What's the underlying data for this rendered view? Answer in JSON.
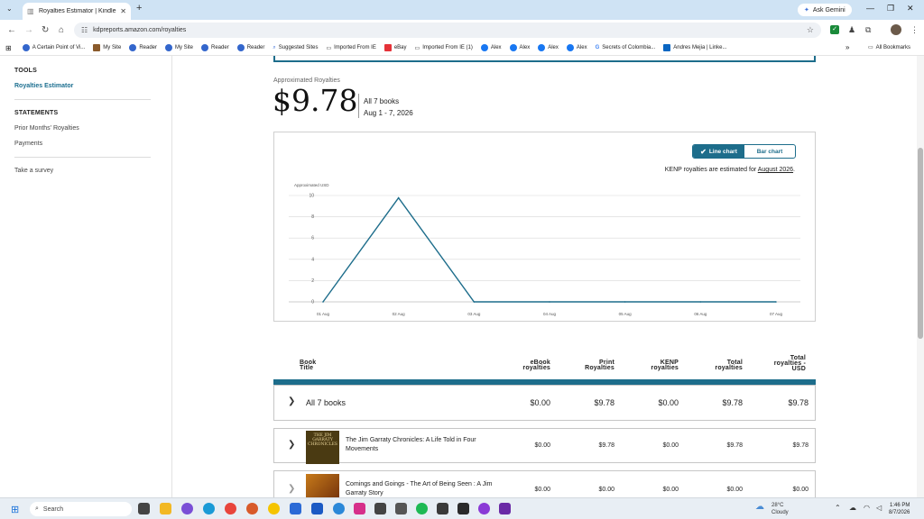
{
  "browser": {
    "tab_title": "Royalties Estimator | Kindle Dire...",
    "ask_gemini": "Ask Gemini",
    "url": "kdpreports.amazon.com/royalties",
    "bookmarks": [
      "A Certain Point of Vi...",
      "My Site",
      "Reader",
      "My Site",
      "Reader",
      "Reader",
      "Suggested Sites",
      "Imported From IE",
      "eBay",
      "Imported From IE (1)",
      "Alex",
      "Alex",
      "Alex",
      "Alex",
      "Secrets of Colombia...",
      "Andres Mejia | Linke..."
    ],
    "all_bookmarks": "All Bookmarks"
  },
  "sidebar": {
    "tools_heading": "TOOLS",
    "royalties_estimator": "Royalties Estimator",
    "statements_heading": "STATEMENTS",
    "prior_months": "Prior Months' Royalties",
    "payments": "Payments",
    "survey": "Take a survey"
  },
  "summary": {
    "label": "Approximated Royalties",
    "amount": "$9.78",
    "books": "All 7 books",
    "dates": "Aug 1 - 7, 2026"
  },
  "chart_controls": {
    "line_chart": "Line chart",
    "bar_chart": "Bar chart",
    "kenp_note_prefix": "KENP royalties are estimated for ",
    "kenp_month": "August 2026",
    "kenp_note_suffix": "."
  },
  "chart_data": {
    "type": "line",
    "ylabel": "Approximated USD",
    "categories": [
      "01 Aug",
      "02 Aug",
      "03 Aug",
      "04 Aug",
      "05 Aug",
      "06 Aug",
      "07 Aug"
    ],
    "series": [
      {
        "values": [
          0,
          9.78,
          0,
          0,
          0,
          0,
          0
        ]
      }
    ],
    "ylim": [
      0,
      10
    ],
    "yticks": [
      0,
      2,
      4,
      6,
      8,
      10
    ],
    "grid": true,
    "color": "#1d6d8b"
  },
  "table": {
    "headers": {
      "title_1": "Book",
      "title_2": "Title",
      "ebook_1": "eBook",
      "ebook_2": "royalties",
      "print_1": "Print",
      "print_2": "Royalties",
      "kenp_1": "KENP",
      "kenp_2": "royalties",
      "total_1": "Total",
      "total_2": "royalties",
      "usd_1": "Total",
      "usd_2": "royalties -",
      "usd_3": "USD"
    },
    "all_row": {
      "label": "All 7 books",
      "ebook": "$0.00",
      "print": "$9.78",
      "kenp": "$0.00",
      "total": "$9.78",
      "usd": "$9.78"
    },
    "rows": [
      {
        "title": "The Jim Garraty Chronicles: A Life Told in Four Movements",
        "cover_text": "THE JIM GARRATY CHRONICLES",
        "ebook": "$0.00",
        "print": "$9.78",
        "kenp": "$0.00",
        "total": "$9.78",
        "usd": "$9.78"
      },
      {
        "title": "Comings and Goings - The Art of Being Seen : A Jim Garraty Story",
        "cover_text": "",
        "ebook": "$0.00",
        "print": "$0.00",
        "kenp": "$0.00",
        "total": "$0.00",
        "usd": "$0.00"
      }
    ]
  },
  "taskbar": {
    "search": "Search",
    "temp": "28°C",
    "weather": "Cloudy",
    "time": "1:46 PM",
    "date": "8/7/2026"
  }
}
